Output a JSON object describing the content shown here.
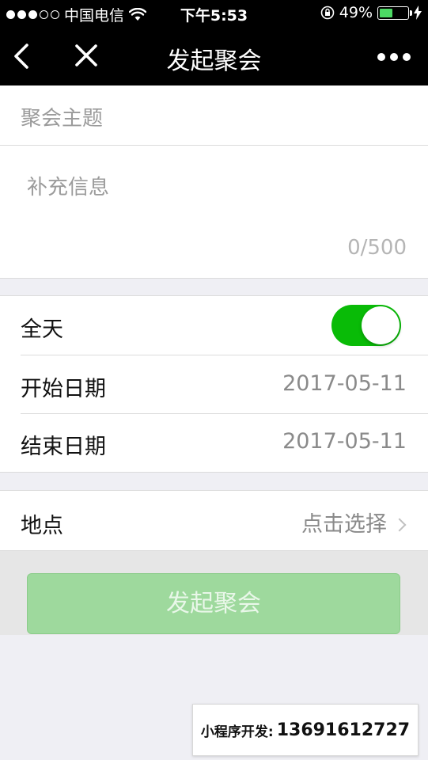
{
  "status_bar": {
    "carrier": "中国电信",
    "time": "下午5:53",
    "battery_percent": "49%",
    "battery_level": 0.49,
    "signal_icon": "signal-dots-icon",
    "wifi_icon": "wifi-icon",
    "orientation_lock_icon": "orientation-lock-icon",
    "charging_icon": "lightning-icon"
  },
  "nav": {
    "title": "发起聚会",
    "back_icon": "chevron-left-icon",
    "close_icon": "close-icon",
    "more_icon": "more-dots-icon"
  },
  "form": {
    "topic_placeholder": "聚会主题",
    "info_placeholder": "补充信息",
    "char_count": "0/500",
    "all_day_label": "全天",
    "all_day_on": true,
    "start_label": "开始日期",
    "start_value": "2017-05-11",
    "end_label": "结束日期",
    "end_value": "2017-05-11",
    "location_label": "地点",
    "location_value": "点击选择"
  },
  "submit": {
    "label": "发起聚会"
  },
  "watermark": {
    "label": "小程序开发:",
    "phone": "13691612727"
  },
  "colors": {
    "navbar": "#000000",
    "switch_on": "#09bb07",
    "button_disabled": "#9ed99d",
    "placeholder": "#9b9b9b"
  }
}
